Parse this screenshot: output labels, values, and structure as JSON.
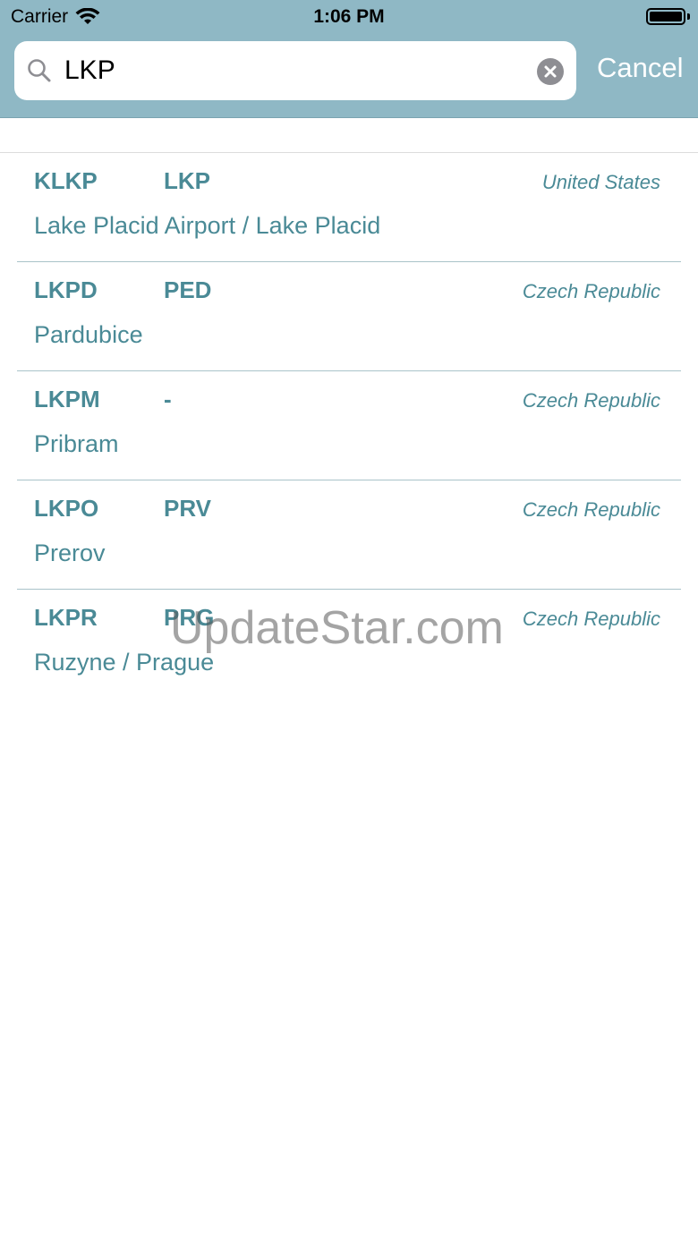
{
  "status_bar": {
    "carrier": "Carrier",
    "time": "1:06 PM"
  },
  "search": {
    "value": "LKP",
    "cancel_label": "Cancel"
  },
  "results": [
    {
      "icao": "KLKP",
      "iata": "LKP",
      "country": "United States",
      "name": "Lake Placid Airport / Lake Placid"
    },
    {
      "icao": "LKPD",
      "iata": "PED",
      "country": "Czech Republic",
      "name": "Pardubice"
    },
    {
      "icao": "LKPM",
      "iata": "-",
      "country": "Czech Republic",
      "name": "Pribram"
    },
    {
      "icao": "LKPO",
      "iata": "PRV",
      "country": "Czech Republic",
      "name": "Prerov"
    },
    {
      "icao": "LKPR",
      "iata": "PRG",
      "country": "Czech Republic",
      "name": "Ruzyne / Prague"
    }
  ],
  "watermark": "UpdateStar.com",
  "colors": {
    "header_bg": "#8fb8c5",
    "accent_text": "#4a8a96",
    "divider": "#a9c3c9"
  },
  "icons": {
    "wifi": "wifi-icon",
    "battery": "battery-icon",
    "search": "search-icon",
    "clear": "clear-icon"
  }
}
